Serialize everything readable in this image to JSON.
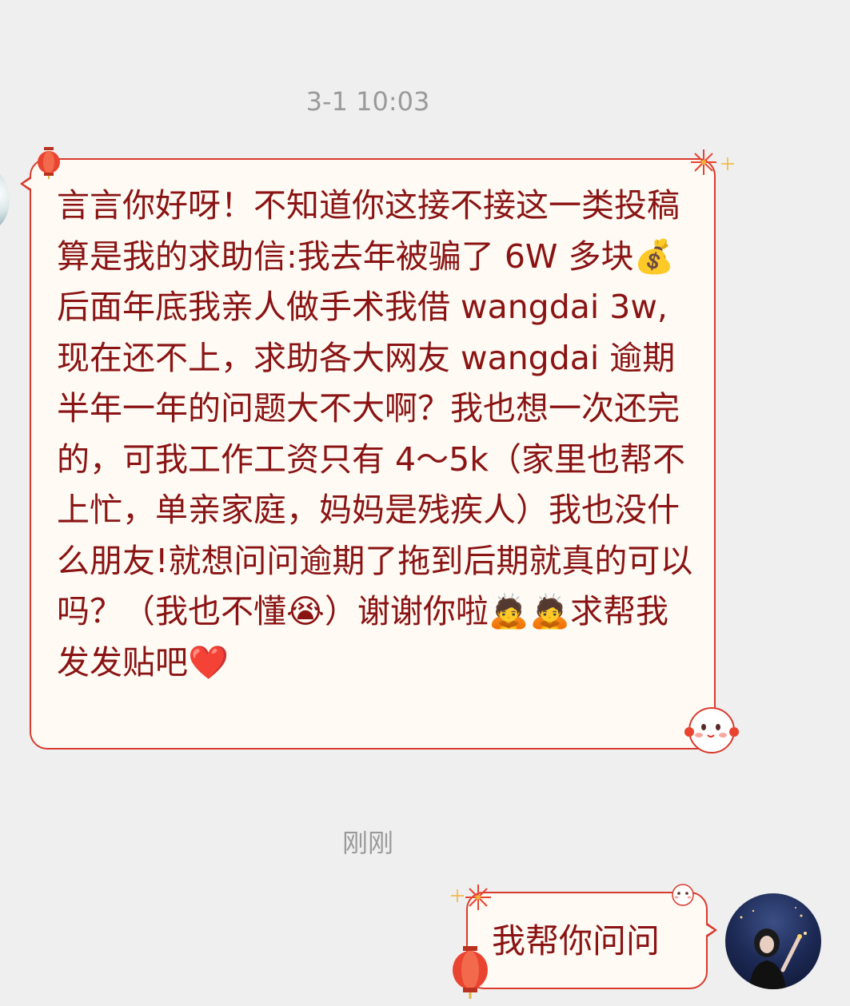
{
  "chat": {
    "timestamp_1": "3-1 10:03",
    "timestamp_2": "刚刚",
    "incoming_message": "言言你好呀！不知道你这接不接这一类投稿算是我的求助信:我去年被骗了 6W 多块💰后面年底我亲人做手术我借 wangdai 3w,现在还不上，求助各大网友 wangdai 逾期半年一年的问题大不大啊？我也想一次还完的，可我工作工资只有 4～5k（家里也帮不上忙，单亲家庭，妈妈是残疾人）我也没什么朋友!就想问问逾期了拖到后期就真的可以吗？（我也不懂😭）谢谢你啦🙇🙇求帮我发发贴吧❤️",
    "outgoing_message": "我帮你问问"
  },
  "colors": {
    "background": "#efefef",
    "bubble_fill": "#fffaf3",
    "bubble_border": "#d93a2e",
    "message_text": "#8a1414",
    "timestamp_text": "#9a9a9a"
  },
  "icons": {
    "bubble_decorations": [
      "lantern-icon",
      "firework-icon",
      "mascot-icon"
    ],
    "avatars": [
      "incoming-avatar",
      "user-avatar"
    ]
  }
}
